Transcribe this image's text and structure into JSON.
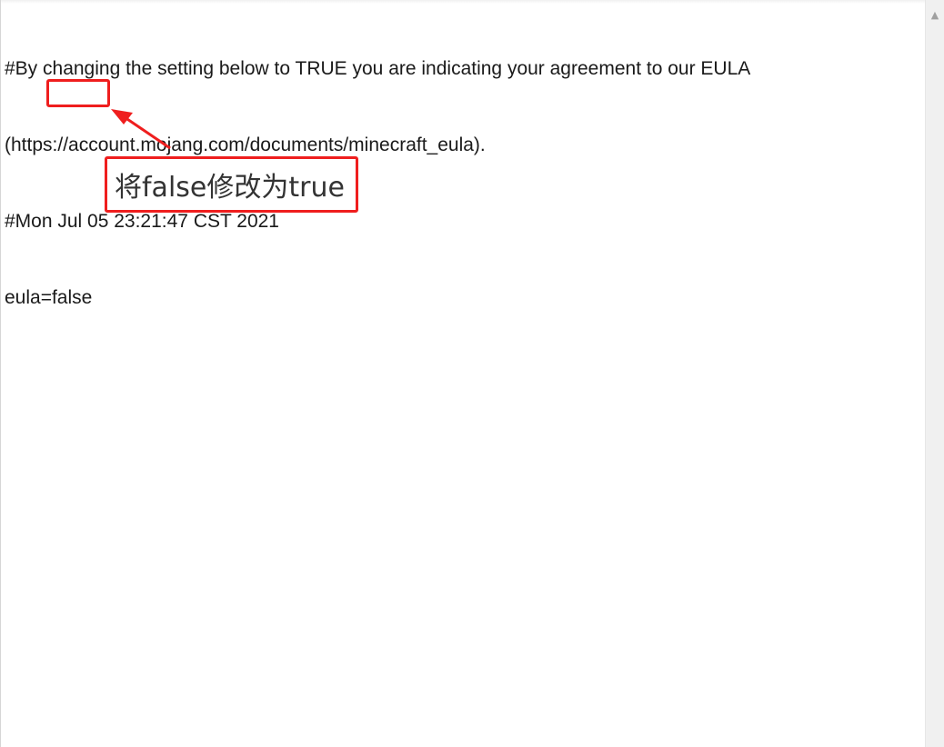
{
  "editor": {
    "lines": [
      "#By changing the setting below to TRUE you are indicating your agreement to our EULA",
      "(https://account.mojang.com/documents/minecraft_eula).",
      "#Mon Jul 05 23:21:47 CST 2021",
      "eula=false"
    ]
  },
  "annotation": {
    "callout_text": "将false修改为true",
    "color": "#ef1e1e",
    "arrow_icon": "arrow-icon"
  },
  "scrollbar": {
    "up_icon": "chevron-up-icon"
  }
}
